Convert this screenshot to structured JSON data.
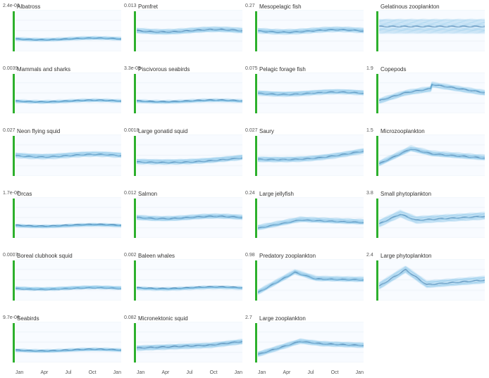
{
  "panels": [
    {
      "id": "albatross",
      "title": "Albatross",
      "ymax": "2.4e-06",
      "row": 0,
      "col": 0,
      "trend": "flat_low",
      "showXLabels": false
    },
    {
      "id": "pomfret",
      "title": "Pomfret",
      "ymax": "0.013",
      "row": 0,
      "col": 1,
      "trend": "flat_mid",
      "showXLabels": false
    },
    {
      "id": "mesopelagic_fish",
      "title": "Mesopelagic fish",
      "ymax": "0.27",
      "row": 0,
      "col": 2,
      "trend": "flat_mid",
      "showXLabels": false
    },
    {
      "id": "gelatinous_zoo",
      "title": "Gelatinous zooplankton",
      "ymax": "",
      "row": 0,
      "col": 3,
      "trend": "flat_high_dense",
      "showXLabels": false
    },
    {
      "id": "mammals_sharks",
      "title": "Mammals and sharks",
      "ymax": "0.0039",
      "row": 1,
      "col": 0,
      "trend": "flat_low",
      "showXLabels": false
    },
    {
      "id": "piscivorous_seabirds",
      "title": "Piscivorous seabirds",
      "ymax": "3.3e-05",
      "row": 1,
      "col": 1,
      "trend": "flat_low",
      "showXLabels": false
    },
    {
      "id": "pelagic_forage_fish",
      "title": "Pelagic forage fish",
      "ymax": "0.075",
      "row": 1,
      "col": 2,
      "trend": "flat_mid",
      "showXLabels": false
    },
    {
      "id": "copepods",
      "title": "Copepods",
      "ymax": "1.9",
      "row": 1,
      "col": 3,
      "trend": "rise_fall",
      "showXLabels": false
    },
    {
      "id": "neon_flying_squid",
      "title": "Neon flying squid",
      "ymax": "0.027",
      "row": 2,
      "col": 0,
      "trend": "flat_mid",
      "showXLabels": false
    },
    {
      "id": "large_gonatid_squid",
      "title": "Large gonatid squid",
      "ymax": "0.0018",
      "row": 2,
      "col": 1,
      "trend": "slight_rise",
      "showXLabels": false
    },
    {
      "id": "saury",
      "title": "Saury",
      "ymax": "0.027",
      "row": 2,
      "col": 2,
      "trend": "rise_spread",
      "showXLabels": false
    },
    {
      "id": "microzooplankton",
      "title": "Microzooplankton",
      "ymax": "1.5",
      "row": 2,
      "col": 3,
      "trend": "rise_peak",
      "showXLabels": false
    },
    {
      "id": "orcas",
      "title": "Orcas",
      "ymax": "1.7e-06",
      "row": 3,
      "col": 0,
      "trend": "flat_low",
      "showXLabels": false
    },
    {
      "id": "salmon",
      "title": "Salmon",
      "ymax": "0.012",
      "row": 3,
      "col": 1,
      "trend": "flat_mid",
      "showXLabels": false
    },
    {
      "id": "large_jellyfish",
      "title": "Large jellyfish",
      "ymax": "0.24",
      "row": 3,
      "col": 2,
      "trend": "rise_mid",
      "showXLabels": false
    },
    {
      "id": "small_phytoplankton",
      "title": "Small phytoplankton",
      "ymax": "3.8",
      "row": 3,
      "col": 3,
      "trend": "peak_early",
      "showXLabels": false
    },
    {
      "id": "boreal_clubhook_squid",
      "title": "Boreal clubhook squid",
      "ymax": "0.0007",
      "row": 4,
      "col": 0,
      "trend": "flat_low",
      "showXLabels": false
    },
    {
      "id": "baleen_whales",
      "title": "Baleen whales",
      "ymax": "0.002",
      "row": 4,
      "col": 1,
      "trend": "flat_low",
      "showXLabels": false
    },
    {
      "id": "predatory_zoo",
      "title": "Predatory zooplankton",
      "ymax": "0.98",
      "row": 4,
      "col": 2,
      "trend": "rise_high",
      "showXLabels": false
    },
    {
      "id": "large_phytoplankton",
      "title": "Large phytoplankton",
      "ymax": "2.4",
      "row": 4,
      "col": 3,
      "trend": "peak_spring",
      "showXLabels": false
    },
    {
      "id": "seabirds",
      "title": "Seabirds",
      "ymax": "9.7e-06",
      "row": 5,
      "col": 0,
      "trend": "flat_low",
      "showXLabels": true
    },
    {
      "id": "micronektonic_squid",
      "title": "Micronektonic squid",
      "ymax": "0.082",
      "row": 5,
      "col": 1,
      "trend": "slight_rise_end",
      "showXLabels": true
    },
    {
      "id": "large_zooplankton",
      "title": "Large zooplankton",
      "ymax": "2.7",
      "row": 5,
      "col": 2,
      "trend": "rise_spread2",
      "showXLabels": true
    },
    {
      "id": "empty_last",
      "title": "",
      "ymax": "",
      "row": 5,
      "col": 3,
      "trend": "none",
      "showXLabels": true
    }
  ],
  "xLabels": [
    "Jan",
    "Apr",
    "Jul",
    "Oct",
    "Jan"
  ],
  "colors": {
    "line_dark": "#1a6ea0",
    "line_light": "#a8d4ef",
    "fill": "rgba(100,180,230,0.15)",
    "green_bar": "#2db02d"
  }
}
